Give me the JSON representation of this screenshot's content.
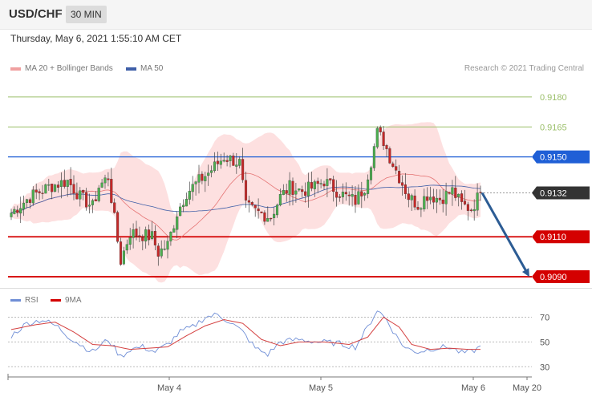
{
  "header": {
    "pair": "USD/CHF",
    "timeframe": "30 MIN"
  },
  "date_text": "Thursday, May 6, 2021 1:55:10 AM CET",
  "credit": "Research © 2021 Trading Central",
  "legend": {
    "ma20": "MA 20 + Bollinger Bands",
    "ma50": "MA 50",
    "rsi": "RSI",
    "ma9": "9MA"
  },
  "colors": {
    "up": "#4caf50",
    "down": "#c62828",
    "band": "#fde0e0",
    "ma20": "#e57373",
    "ma50": "#3f5fa8",
    "resistance_green": "#9bbf6a",
    "resistance_blue": "#1f5fd6",
    "support_red": "#d40000",
    "current": "#333333",
    "rsi": "#6f8ed6",
    "ma9": "#d44040",
    "arrow": "#2c5c94"
  },
  "chart_data": [
    {
      "type": "candlestick",
      "x_labels": [
        "May 4",
        "May 5",
        "May 6",
        "May 20"
      ],
      "ylim": [
        0.9086,
        0.919
      ],
      "levels": [
        {
          "value": 0.918,
          "label": "0.9180",
          "kind": "resistance"
        },
        {
          "value": 0.9165,
          "label": "0.9165",
          "kind": "resistance"
        },
        {
          "value": 0.915,
          "label": "0.9150",
          "kind": "resistance-key"
        },
        {
          "value": 0.9132,
          "label": "0.9132",
          "kind": "current"
        },
        {
          "value": 0.911,
          "label": "0.9110",
          "kind": "support"
        },
        {
          "value": 0.909,
          "label": "0.9090",
          "kind": "support-key"
        }
      ],
      "projection": {
        "from": 0.9132,
        "to": 0.909
      },
      "price_anchors": [
        [
          0,
          0.9122
        ],
        [
          6,
          0.913
        ],
        [
          12,
          0.9135
        ],
        [
          18,
          0.9138
        ],
        [
          22,
          0.913
        ],
        [
          26,
          0.9125
        ],
        [
          28,
          0.9135
        ],
        [
          31,
          0.914
        ],
        [
          34,
          0.9108
        ],
        [
          35,
          0.9098
        ],
        [
          38,
          0.9112
        ],
        [
          45,
          0.911
        ],
        [
          47,
          0.9102
        ],
        [
          50,
          0.9106
        ],
        [
          53,
          0.9122
        ],
        [
          56,
          0.9132
        ],
        [
          60,
          0.9138
        ],
        [
          63,
          0.9142
        ],
        [
          68,
          0.915
        ],
        [
          73,
          0.9147
        ],
        [
          75,
          0.9125
        ],
        [
          79,
          0.9122
        ],
        [
          83,
          0.912
        ],
        [
          86,
          0.913
        ],
        [
          89,
          0.9135
        ],
        [
          93,
          0.9133
        ],
        [
          97,
          0.9135
        ],
        [
          100,
          0.9138
        ],
        [
          104,
          0.9133
        ],
        [
          107,
          0.913
        ],
        [
          110,
          0.9128
        ],
        [
          113,
          0.9135
        ],
        [
          115,
          0.9148
        ],
        [
          117,
          0.9162
        ],
        [
          119,
          0.9158
        ],
        [
          121,
          0.915
        ],
        [
          124,
          0.914
        ],
        [
          127,
          0.913
        ],
        [
          130,
          0.9126
        ],
        [
          133,
          0.9131
        ],
        [
          137,
          0.9129
        ],
        [
          141,
          0.9133
        ],
        [
          144,
          0.9126
        ],
        [
          147,
          0.9124
        ],
        [
          150,
          0.9132
        ]
      ]
    },
    {
      "type": "line",
      "name": "RSI",
      "yticks": [
        70,
        50,
        30
      ],
      "ylim": [
        25,
        80
      ],
      "rsi_anchors": [
        [
          0,
          55
        ],
        [
          5,
          65
        ],
        [
          10,
          68
        ],
        [
          15,
          62
        ],
        [
          18,
          55
        ],
        [
          22,
          48
        ],
        [
          26,
          42
        ],
        [
          31,
          52
        ],
        [
          35,
          38
        ],
        [
          38,
          44
        ],
        [
          42,
          46
        ],
        [
          46,
          42
        ],
        [
          50,
          48
        ],
        [
          54,
          58
        ],
        [
          58,
          62
        ],
        [
          62,
          70
        ],
        [
          66,
          72
        ],
        [
          70,
          66
        ],
        [
          74,
          58
        ],
        [
          78,
          45
        ],
        [
          82,
          40
        ],
        [
          86,
          50
        ],
        [
          92,
          52
        ],
        [
          98,
          50
        ],
        [
          104,
          49
        ],
        [
          110,
          46
        ],
        [
          114,
          62
        ],
        [
          117,
          76
        ],
        [
          120,
          68
        ],
        [
          123,
          55
        ],
        [
          126,
          45
        ],
        [
          130,
          42
        ],
        [
          135,
          45
        ],
        [
          140,
          46
        ],
        [
          144,
          41
        ],
        [
          147,
          42
        ],
        [
          150,
          46
        ]
      ],
      "ma9_anchors": [
        [
          0,
          60
        ],
        [
          8,
          64
        ],
        [
          14,
          66
        ],
        [
          20,
          58
        ],
        [
          26,
          48
        ],
        [
          32,
          47
        ],
        [
          38,
          44
        ],
        [
          44,
          45
        ],
        [
          50,
          46
        ],
        [
          56,
          55
        ],
        [
          62,
          63
        ],
        [
          68,
          68
        ],
        [
          74,
          65
        ],
        [
          80,
          52
        ],
        [
          86,
          47
        ],
        [
          92,
          50
        ],
        [
          100,
          50
        ],
        [
          108,
          48
        ],
        [
          114,
          54
        ],
        [
          119,
          70
        ],
        [
          124,
          62
        ],
        [
          128,
          48
        ],
        [
          134,
          44
        ],
        [
          140,
          45
        ],
        [
          146,
          44
        ],
        [
          150,
          44
        ]
      ]
    }
  ]
}
